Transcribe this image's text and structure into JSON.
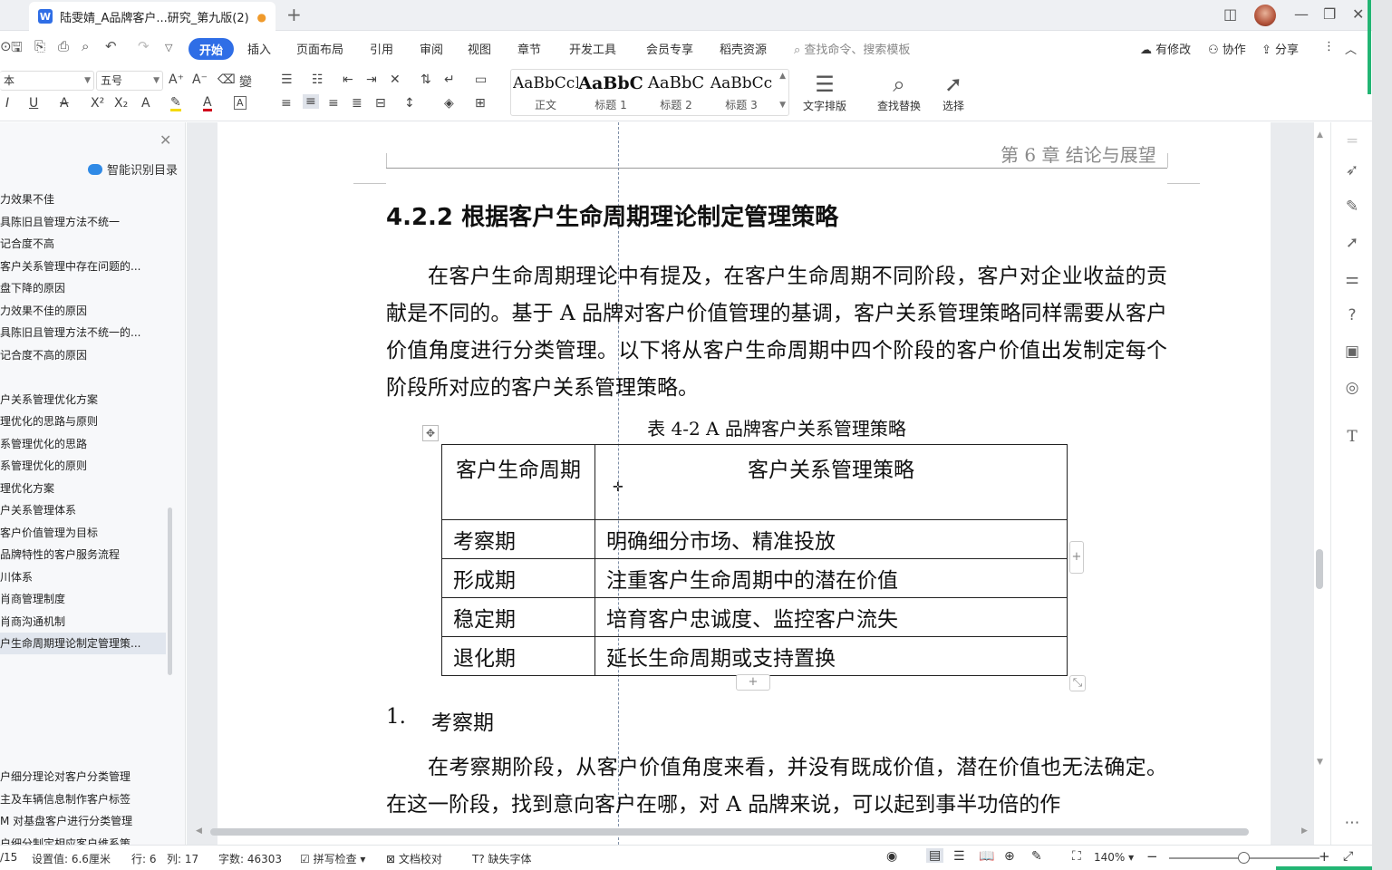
{
  "window": {
    "tab_title": "陆雯婧_A品牌客户...研究_第九版(2)",
    "tab_icon": "W",
    "unsaved_dot": "●",
    "new_tab": "+",
    "controls": {
      "layout": "◫",
      "minimize": "—",
      "restore": "❐",
      "close": "✕"
    }
  },
  "menubar": {
    "items": [
      "开始",
      "插入",
      "页面布局",
      "引用",
      "审阅",
      "视图",
      "章节",
      "开发工具",
      "会员专享",
      "稻壳资源"
    ],
    "search_placeholder": "查找命令、搜索模板",
    "right": [
      "有修改",
      "协作",
      "分享"
    ]
  },
  "toolbar": {
    "font_name": "本",
    "font_size": "五号",
    "styles": [
      {
        "sample": "AaBbCcI",
        "name": "正文"
      },
      {
        "sample": "AaBbC",
        "name": "标题 1"
      },
      {
        "sample": "AaBbC",
        "name": "标题 2"
      },
      {
        "sample": "AaBbCc",
        "name": "标题 3"
      }
    ],
    "text_layout": "文字排版",
    "find_replace": "查找替换",
    "select": "选择"
  },
  "toc": {
    "smart_label": "智能识别目录",
    "items": [
      "力效果不佳",
      "具陈旧且管理方法不统一",
      "记合度不高",
      "客户关系管理中存在问题的...",
      "盘下降的原因",
      "力效果不佳的原因",
      "具陈旧且管理方法不统一的...",
      "记合度不高的原因",
      "",
      "户关系管理优化方案",
      "理优化的思路与原则",
      "系管理优化的思路",
      "系管理优化的原则",
      "理优化方案",
      "户关系管理体系",
      "客户价值管理为目标",
      "品牌特性的客户服务流程",
      "川体系",
      "肖商管理制度",
      "肖商沟通机制",
      "户生命周期理论制定管理策...",
      "",
      "",
      "",
      "",
      "",
      "户细分理论对客户分类管理",
      "主及车辆信息制作客户标签",
      "M 对基盘客户进行分类管理",
      "户细分制定相应客户维系策..."
    ],
    "active_index": 20
  },
  "document": {
    "running_header": "第 6 章 结论与展望",
    "heading": "4.2.2  根据客户生命周期理论制定管理策略",
    "paragraph1": "在客户生命周期理论中有提及，在客户生命周期不同阶段，客户对企业收益的贡献是不同的。基于 A 品牌对客户价值管理的基调，客户关系管理策略同样需要从客户价值角度进行分类管理。以下将从客户生命周期中四个阶段的客户价值出发制定每个阶段所对应的客户关系管理策略。",
    "table_caption": "表 4-2 A 品牌客户关系管理策略",
    "table": {
      "headers": [
        "客户生命周期",
        "客户关系管理策略"
      ],
      "rows": [
        [
          "考察期",
          "明确细分市场、精准投放"
        ],
        [
          "形成期",
          "注重客户生命周期中的潜在价值"
        ],
        [
          "稳定期",
          "培育客户忠诚度、监控客户流失"
        ],
        [
          "退化期",
          "延长生命周期或支持置换"
        ]
      ]
    },
    "list_number": "1.",
    "list_text": "考察期",
    "paragraph2": "在考察期阶段，从客户价值角度来看，并没有既成价值，潜在价值也无法确定。在这一阶段，找到意向客户在哪，对 A 品牌来说，可以起到事半功倍的作"
  },
  "statusbar": {
    "page": "/15",
    "setting": "设置值: 6.6厘米",
    "row": "行: 6",
    "col": "列: 17",
    "words": "字数: 46303",
    "spell": "拼写检查",
    "proof": "文档校对",
    "missing_font": "缺失字体",
    "zoom": "140%"
  },
  "colors": {
    "accent": "#2f6ee6",
    "green": "#22b573"
  }
}
